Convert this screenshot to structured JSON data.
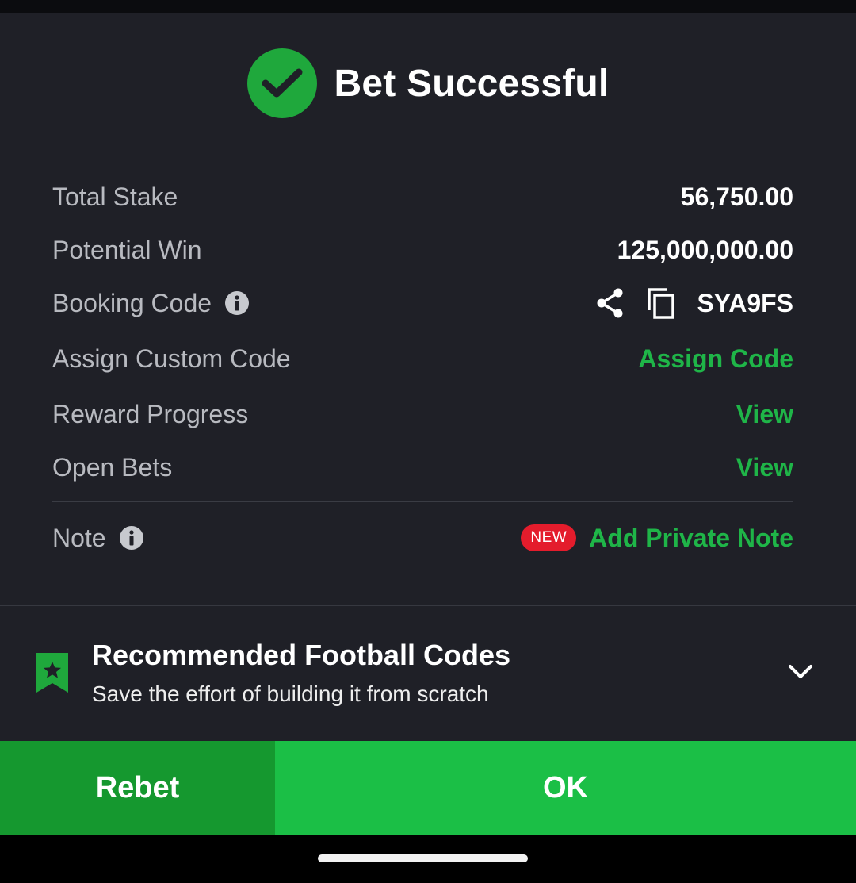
{
  "header": {
    "title": "Bet Successful",
    "icon": "check-circle-icon",
    "accent": "#1fa83c"
  },
  "details": {
    "total_stake": {
      "label": "Total Stake",
      "value": "56,750.00"
    },
    "potential_win": {
      "label": "Potential Win",
      "value": "125,000,000.00"
    },
    "booking_code": {
      "label": "Booking Code",
      "value": "SYA9FS"
    },
    "custom_code": {
      "label": "Assign Custom Code",
      "action": "Assign Code"
    },
    "reward_progress": {
      "label": "Reward Progress",
      "action": "View"
    },
    "open_bets": {
      "label": "Open Bets",
      "action": "View"
    },
    "note": {
      "label": "Note",
      "badge": "NEW",
      "action": "Add Private Note"
    }
  },
  "recommended": {
    "title": "Recommended Football Codes",
    "subtitle": "Save the effort of building it from scratch"
  },
  "buttons": {
    "rebet": "Rebet",
    "ok": "OK"
  },
  "colors": {
    "background": "#1f2027",
    "green_link": "#1fb548",
    "rebet_bg": "#15982f",
    "ok_bg": "#1bbf46",
    "badge_red": "#e41c2c"
  }
}
